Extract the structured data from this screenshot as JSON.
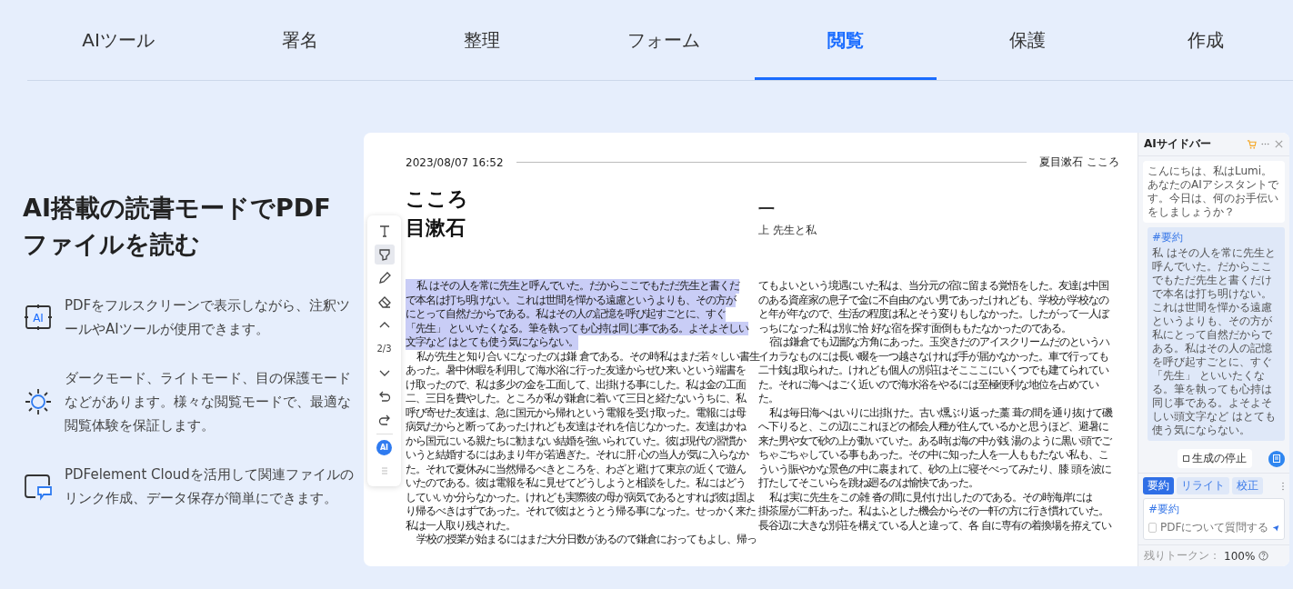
{
  "nav": {
    "tabs": [
      {
        "label": "AIツール",
        "selected": false
      },
      {
        "label": "署名",
        "selected": false
      },
      {
        "label": "整理",
        "selected": false
      },
      {
        "label": "フォーム",
        "selected": false
      },
      {
        "label": "閲覧",
        "selected": true
      },
      {
        "label": "保護",
        "selected": false
      },
      {
        "label": "作成",
        "selected": false
      }
    ]
  },
  "intro": {
    "heading_lines": [
      "AI搭載の読書モードでPDF",
      "ファイルを読む"
    ],
    "features": [
      {
        "kind": "ai",
        "icon_label": "AI",
        "text": "PDFをフルスクリーンで表示しながら、注釈ツールやAIツールが使用できます。"
      },
      {
        "kind": "sun",
        "text": "ダークモード、ライトモード、目の保護モードなどがあります。様々な閲覧モードで、最適な閲覧体験を保証します。"
      },
      {
        "kind": "cloud",
        "text": "PDFelement Cloudを活用して関連ファイルのリンク作成、データ保存が簡単にできます。"
      }
    ]
  },
  "document": {
    "date": "2023/08/07 16:52",
    "running_head": "夏目漱石 こころ",
    "title": "こころ",
    "author": "目漱石",
    "chapter_number": "一",
    "chapter_title": "上 先生と私",
    "left_lines": [
      {
        "text": "私 はその人を常に先生と呼んでいた。だからここでもただ先生と書くだ",
        "indent": true,
        "highlighted": true
      },
      {
        "text": "で本名は打ち明けない。これは世間を憚かる遠慮というよりも、その方が",
        "indent": false,
        "highlighted": true
      },
      {
        "text": "にとって自然だからである。私はその人の記憶を呼び起すごとに、すぐ",
        "indent": false,
        "highlighted": true
      },
      {
        "text": "「先生」 といいたくなる。筆を執っても心持は同じ事である。よそよそしい",
        "indent": false,
        "highlighted": true
      },
      {
        "text": "文字など はとても使う気にならない。",
        "indent": false,
        "highlighted": true
      },
      {
        "text": "私が先生と知り合いになったのは鎌 倉である。その時私はまだ若々しい書生",
        "indent": true,
        "highlighted": false
      },
      {
        "text": "あった。暑中休暇を利用して海水浴に行った友達からぜひ来いという端書を",
        "indent": false,
        "highlighted": false
      },
      {
        "text": "け取ったので、私は多少の金を工面して、出掛ける事にした。私は金の工面",
        "indent": false,
        "highlighted": false
      },
      {
        "text": "二、三日を費やした。ところが私が鎌倉に着いて三日と経たないうちに、私",
        "indent": false,
        "highlighted": false
      },
      {
        "text": "呼び寄せた友達は、急に国元から帰れという電報を受け取った。電報には母",
        "indent": false,
        "highlighted": false
      },
      {
        "text": "病気だからと断ってあったけれども友達はそれを信じなかった。友達はかね",
        "indent": false,
        "highlighted": false
      },
      {
        "text": "から国元にいる親たちに勧まない結婚を強いられていた。彼は現代の習慣か",
        "indent": false,
        "highlighted": false
      },
      {
        "text": "いうと結婚するにはあまり年が若過ぎた。それに肝 心の当人が気に入らなか",
        "indent": false,
        "highlighted": false
      },
      {
        "text": "た。それで夏休みに当然帰るべきところを、わざと避けて東京の近くで遊ん",
        "indent": false,
        "highlighted": false
      },
      {
        "text": "いたのである。彼は電報を私に見せてどうしようと相談をした。私にはどう",
        "indent": false,
        "highlighted": false
      },
      {
        "text": "していいか分らなかった。けれども実際彼の母が病気であるとすれば彼は固よ",
        "indent": false,
        "highlighted": false
      },
      {
        "text": "り帰るべきはずであった。それで彼はとうとう帰る事になった。せっかく来た",
        "indent": false,
        "highlighted": false
      },
      {
        "text": "私は一人取り残された。",
        "indent": false,
        "highlighted": false
      },
      {
        "text": "学校の授業が始まるにはまだ大分日数があるので鎌倉におってもよし、帰っ",
        "indent": true,
        "highlighted": false
      }
    ],
    "right_lines": [
      {
        "text": "てもよいという境遇にいた私は、当分元の宿に留まる覚悟をした。友達は中国",
        "indent": false
      },
      {
        "text": "のある資産家の息子で金に不自由のない男であったけれども、学校が学校なの",
        "indent": false
      },
      {
        "text": "と年が年なので、生活の程度は私とそう変りもしなかった。したがって一人ぼ",
        "indent": false
      },
      {
        "text": "っちになった私は別に恰 好な宿を探す面倒ももたなかったのである。",
        "indent": false
      },
      {
        "text": "宿は鎌倉でも辺鄙な方角にあった。玉突きだのアイスクリームだのというハ",
        "indent": true
      },
      {
        "text": "イカラなものには長い畷を一つ越さなければ手が届かなかった。車で行っても",
        "indent": false
      },
      {
        "text": "二十銭は取られた。けれども個人の別荘はそこここにいくつでも建てられてい",
        "indent": false
      },
      {
        "text": "た。それに海へはごく近いので海水浴をやるには至極便利な地位を占めてい",
        "indent": false
      },
      {
        "text": "た。",
        "indent": false
      },
      {
        "text": "私は毎日海へはいりに出掛けた。古い燻ぶり返った藁 葺の間を通り抜けて磯",
        "indent": true
      },
      {
        "text": "へ下りると、この辺にこれほどの都会人種が住んでいるかと思うほど、避暑に",
        "indent": false
      },
      {
        "text": "来た男や女で砂の上が動いていた。ある時は海の中が銭 湯のように黒い頭でご",
        "indent": false
      },
      {
        "text": "ちゃごちゃしている事もあった。その中に知った人を一人ももたない私も、こ",
        "indent": false
      },
      {
        "text": "ういう賑やかな景色の中に裹まれて、砂の上に寝そべってみたり、膝 頭を波に",
        "indent": false
      },
      {
        "text": "打たしてそこいらを跳ね廻るのは愉快であった。",
        "indent": false
      },
      {
        "text": "私は実に先生をこの雑 沓の間に見付け出したのである。その時海岸には",
        "indent": true
      },
      {
        "text": "掛茶屋が二軒あった。私はふとした機会からその一軒の方に行き慣れていた。",
        "indent": false
      },
      {
        "text": "長谷辺に大きな別荘を構えている人と違って、各 自に専有の着換場を拵えてい",
        "indent": false
      }
    ]
  },
  "toolbar": {
    "tools": [
      {
        "kind": "text",
        "selected": false
      },
      {
        "kind": "highlighter",
        "selected": true
      },
      {
        "kind": "pencil",
        "selected": false
      },
      {
        "kind": "eraser",
        "selected": false
      }
    ],
    "controls": [
      {
        "kind": "up"
      },
      {
        "kind": "page",
        "label": "2/3"
      },
      {
        "kind": "down"
      },
      {
        "kind": "undo"
      },
      {
        "kind": "redo"
      },
      {
        "kind": "ai",
        "label": "AI"
      },
      {
        "kind": "handle"
      }
    ]
  },
  "sidebar": {
    "title": "AIサイドバー",
    "bot_message": "こんにちは、私はLumi。あなたのAIアシスタントです。今日は、何のお手伝いをしましょうか？",
    "user_message": {
      "tag": "#要約",
      "text": "私 はその人を常に先生と呼んでいた。だからここでもただ先生と書くだけで本名は打ち明けない。これは世間を憚かる遠慮というよりも、その方が私にとって自然だからである。私はその人の記憶を呼び起すごとに、すぐ「先生」 といいたくなる。筆を執っても心持は同じ事である。よそよそしい頭文字など はとても使う気にならない。"
    },
    "stop_button": "生成の停止",
    "tabs": [
      {
        "label": "要約",
        "selected": true
      },
      {
        "label": "リライト",
        "selected": false
      },
      {
        "label": "校正",
        "selected": false
      }
    ],
    "input": {
      "value": "#要約",
      "checkbox_label": "PDFについて質問する",
      "checked": false
    },
    "tokens_label": "残りトークン：",
    "tokens_value": "100%"
  }
}
